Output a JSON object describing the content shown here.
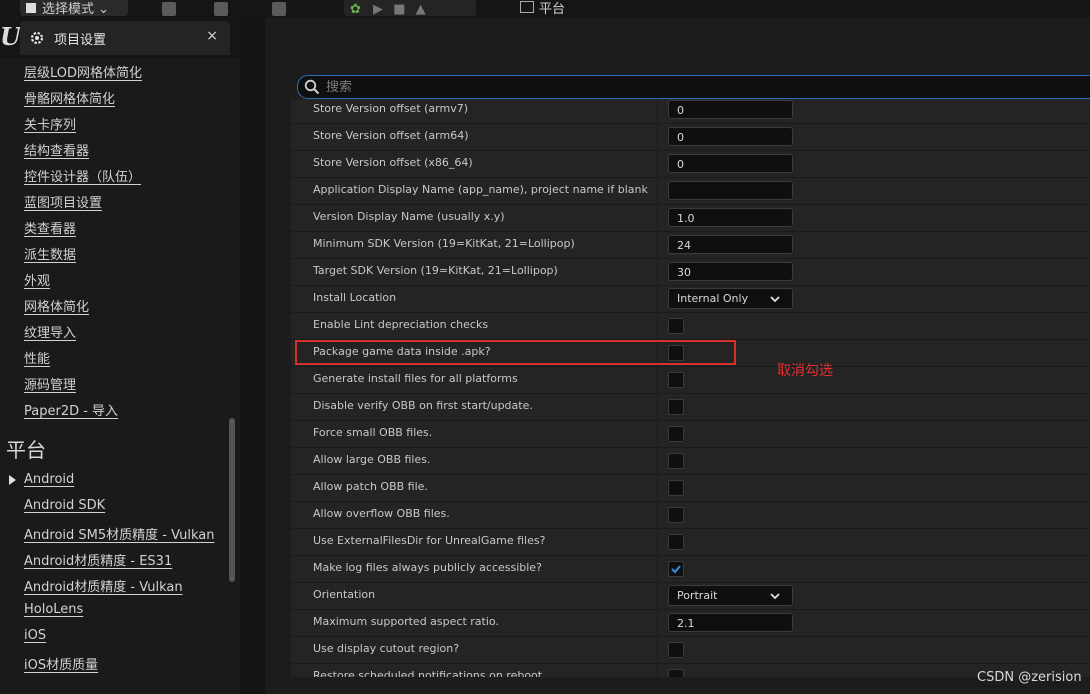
{
  "toolbar": {
    "select_mode_label": "选择模式",
    "platforms_label": "平台"
  },
  "window": {
    "logo_text": "U",
    "tab_title": "项目设置",
    "close_glyph": "×"
  },
  "sidebar": {
    "items": [
      "层级LOD网格体简化",
      "骨骼网格体简化",
      "关卡序列",
      "结构查看器",
      "控件设计器（队伍）",
      "蓝图项目设置",
      "类查看器",
      "派生数据",
      "外观",
      "网格体简化",
      "纹理导入",
      "性能",
      "源码管理",
      "Paper2D - 导入"
    ],
    "section_title": "平台",
    "platform_items": [
      "Android",
      "Android SDK",
      "Android SM5材质精度 - Vulkan",
      "Android材质精度 - ES31",
      "Android材质精度 - Vulkan",
      "HoloLens",
      "iOS",
      "iOS材质质量"
    ]
  },
  "search": {
    "placeholder": "搜索"
  },
  "settings": {
    "rows": [
      {
        "label": "Store Version offset (armv7)",
        "type": "text",
        "value": "0"
      },
      {
        "label": "Store Version offset (arm64)",
        "type": "text",
        "value": "0"
      },
      {
        "label": "Store Version offset (x86_64)",
        "type": "text",
        "value": "0"
      },
      {
        "label": "Application Display Name (app_name), project name if blank",
        "type": "text",
        "value": ""
      },
      {
        "label": "Version Display Name (usually x.y)",
        "type": "text",
        "value": "1.0"
      },
      {
        "label": "Minimum SDK Version (19=KitKat, 21=Lollipop)",
        "type": "text",
        "value": "24"
      },
      {
        "label": "Target SDK Version (19=KitKat, 21=Lollipop)",
        "type": "text",
        "value": "30"
      },
      {
        "label": "Install Location",
        "type": "dropdown",
        "value": "Internal Only"
      },
      {
        "label": "Enable Lint depreciation checks",
        "type": "checkbox",
        "checked": false
      },
      {
        "label": "Package game data inside .apk?",
        "type": "checkbox",
        "checked": false
      },
      {
        "label": "Generate install files for all platforms",
        "type": "checkbox",
        "checked": false
      },
      {
        "label": "Disable verify OBB on first start/update.",
        "type": "checkbox",
        "checked": false
      },
      {
        "label": "Force small OBB files.",
        "type": "checkbox",
        "checked": false
      },
      {
        "label": "Allow large OBB files.",
        "type": "checkbox",
        "checked": false
      },
      {
        "label": "Allow patch OBB file.",
        "type": "checkbox",
        "checked": false
      },
      {
        "label": "Allow overflow OBB files.",
        "type": "checkbox",
        "checked": false
      },
      {
        "label": "Use ExternalFilesDir for UnrealGame files?",
        "type": "checkbox",
        "checked": false
      },
      {
        "label": "Make log files always publicly accessible?",
        "type": "checkbox",
        "checked": true
      },
      {
        "label": "Orientation",
        "type": "dropdown",
        "value": "Portrait"
      },
      {
        "label": "Maximum supported aspect ratio.",
        "type": "text",
        "value": "2.1"
      },
      {
        "label": "Use display cutout region?",
        "type": "checkbox",
        "checked": false
      },
      {
        "label": "Restore scheduled notifications on reboot",
        "type": "checkbox",
        "checked": false
      }
    ]
  },
  "annotation": {
    "text": "取消勾选",
    "color": "#e03030"
  },
  "watermark": "CSDN @zerision",
  "colors": {
    "accent_blue": "#2c6fb5",
    "check_blue": "#2f8fe0",
    "highlight_red": "#d8302c"
  }
}
